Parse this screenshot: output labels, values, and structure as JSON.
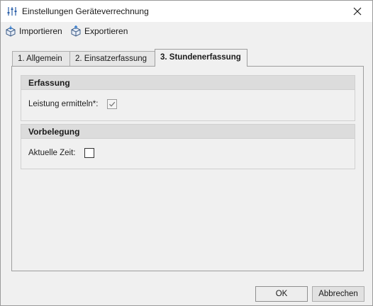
{
  "window": {
    "title": "Einstellungen Geräteverrechnung",
    "title_icon": "sliders-icon"
  },
  "toolbar": {
    "import_label": "Importieren",
    "export_label": "Exportieren"
  },
  "tabs": [
    {
      "label": "1. Allgemein",
      "active": false
    },
    {
      "label": "2. Einsatzerfassung",
      "active": false
    },
    {
      "label": "3. Stundenerfassung",
      "active": true
    }
  ],
  "groups": {
    "erfassung": {
      "title": "Erfassung",
      "field_label": "Leistung ermitteln*:",
      "checked": true,
      "enabled": false
    },
    "vorbelegung": {
      "title": "Vorbelegung",
      "field_label": "Aktuelle Zeit:",
      "checked": false,
      "enabled": true
    }
  },
  "footer": {
    "ok_label": "OK",
    "cancel_label": "Abbrechen"
  }
}
